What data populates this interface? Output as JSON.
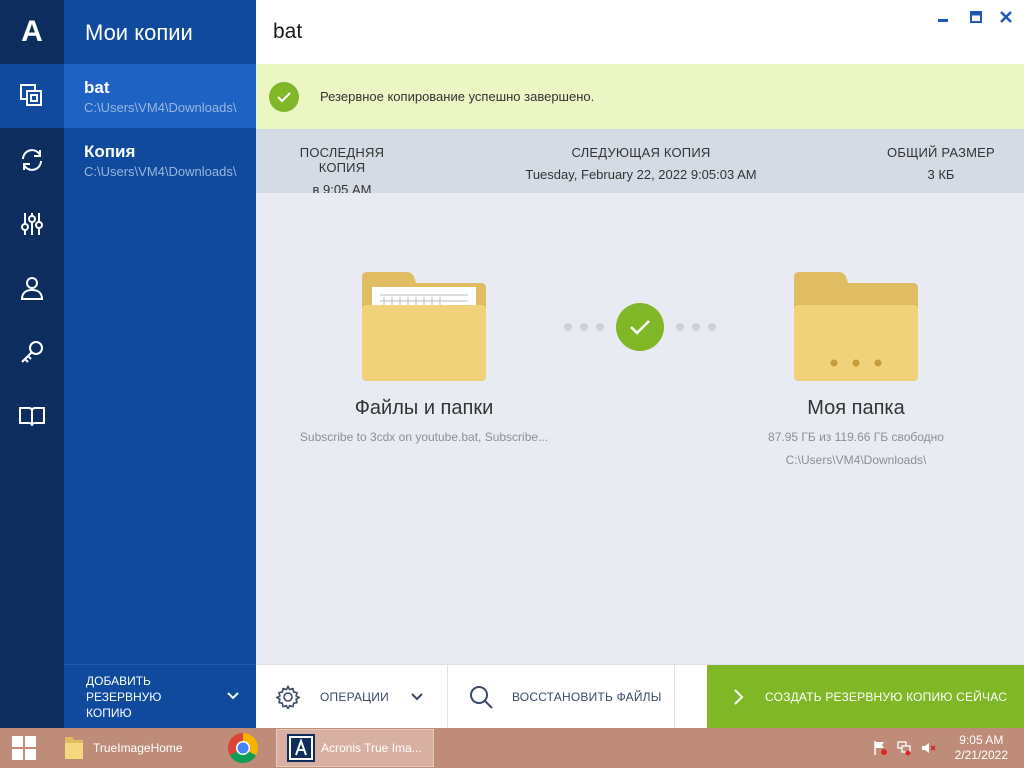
{
  "app": {
    "logo_letter": "A",
    "panel_title": "Мои копии",
    "header_title": "bat"
  },
  "rail": {
    "items": [
      {
        "icon": "copies-icon",
        "active": true
      },
      {
        "icon": "sync-icon",
        "active": false
      },
      {
        "icon": "tools-icon",
        "active": false
      },
      {
        "icon": "account-icon",
        "active": false
      },
      {
        "icon": "key-icon",
        "active": false
      },
      {
        "icon": "book-icon",
        "active": false
      }
    ]
  },
  "backups": [
    {
      "name": "bat",
      "path": "C:\\Users\\VM4\\Downloads\\",
      "active": true
    },
    {
      "name": "Копия",
      "path": "C:\\Users\\VM4\\Downloads\\",
      "active": false
    }
  ],
  "add_backup": {
    "label": "ДОБАВИТЬ РЕЗЕРВНУЮ КОПИЮ"
  },
  "banner": {
    "text": "Резервное копирование успешно завершено."
  },
  "stats": {
    "last_label": "ПОСЛЕДНЯЯ КОПИЯ",
    "last_value": "в 9:05 AM",
    "next_label": "СЛЕДУЮЩАЯ КОПИЯ",
    "next_value": "Tuesday, February 22, 2022 9:05:03 AM",
    "size_label": "ОБЩИЙ РАЗМЕР",
    "size_value": "3 КБ"
  },
  "source": {
    "title": "Файлы и папки",
    "subtitle": "Subscribe to 3cdx on youtube.bat, Subscribe..."
  },
  "destination": {
    "title": "Моя папка",
    "free_space": "87.95 ГБ из 119.66 ГБ свободно",
    "path": "C:\\Users\\VM4\\Downloads\\"
  },
  "toolbar": {
    "operations_label": "ОПЕРАЦИИ",
    "restore_label": "ВОССТАНОВИТЬ ФАЙЛЫ",
    "backup_now_label": "СОЗДАТЬ РЕЗЕРВНУЮ КОПИЮ СЕЙЧАС"
  },
  "taskbar": {
    "items": [
      {
        "label": "TrueImageHome",
        "icon": "folder-icon"
      },
      {
        "label": "",
        "icon": "chrome-icon"
      },
      {
        "label": "Acronis True Ima...",
        "icon": "acronis-icon"
      }
    ],
    "time": "9:05 AM",
    "date": "2/21/2022"
  },
  "colors": {
    "rail": "#0c2d5e",
    "panel": "#0f4a9c",
    "panel_active": "#1e63c4",
    "accent_green": "#7fb726",
    "banner_bg": "#ecf6c4",
    "folder": "#f0d27a"
  }
}
